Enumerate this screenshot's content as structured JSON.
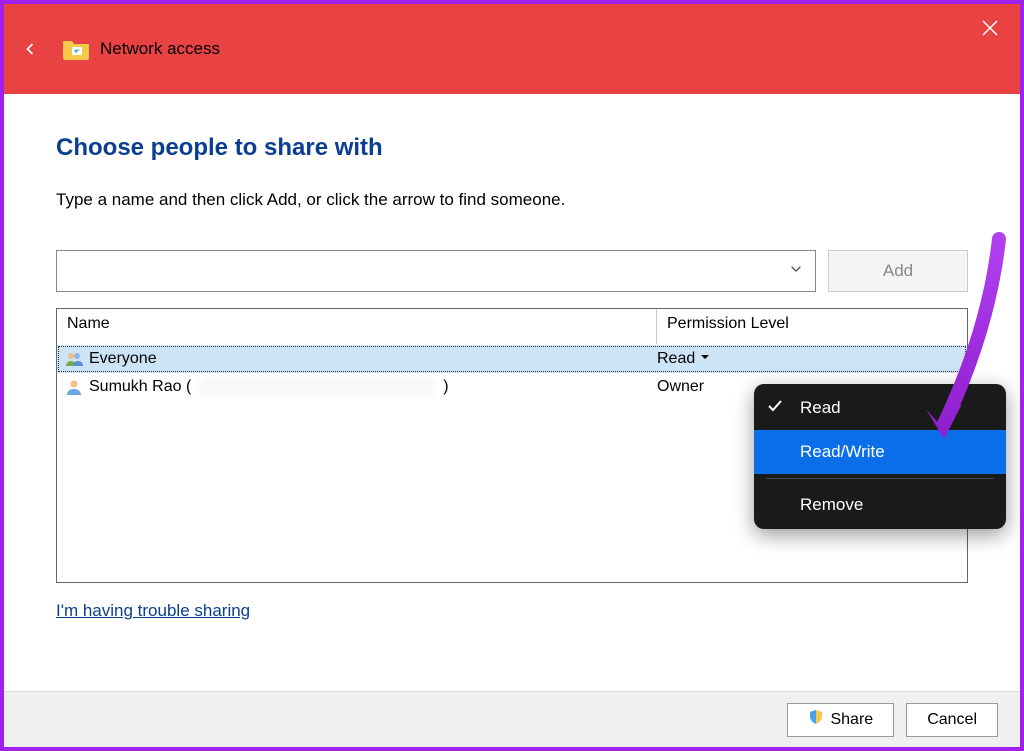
{
  "header": {
    "title": "Network access"
  },
  "main": {
    "heading": "Choose people to share with",
    "instruction": "Type a name and then click Add, or click the arrow to find someone.",
    "add_button": "Add",
    "columns": {
      "name": "Name",
      "permission": "Permission Level"
    },
    "rows": [
      {
        "name": "Everyone",
        "permission": "Read",
        "selected": true,
        "user_type": "group"
      },
      {
        "name": "Sumukh Rao (",
        "name_suffix": ")",
        "permission": "Owner",
        "selected": false,
        "user_type": "user"
      }
    ],
    "trouble_link": "I'm having trouble sharing"
  },
  "context_menu": {
    "items": [
      {
        "label": "Read",
        "checked": true,
        "highlighted": false
      },
      {
        "label": "Read/Write",
        "checked": false,
        "highlighted": true
      }
    ],
    "remove": "Remove"
  },
  "footer": {
    "share": "Share",
    "cancel": "Cancel"
  }
}
